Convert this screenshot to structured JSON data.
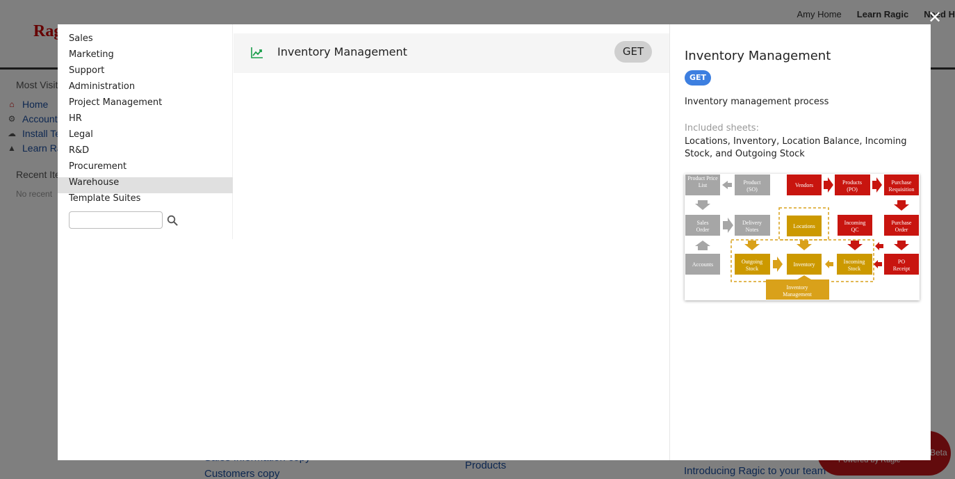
{
  "background": {
    "logo": "Rag",
    "user_menu": [
      "Amy Home",
      "Learn Ragic",
      "Need H"
    ],
    "sidebar": {
      "most_visited_title": "Most Visit",
      "items": [
        {
          "label": "Home",
          "icon": "home-icon"
        },
        {
          "label": "Account",
          "icon": "gear-icon"
        },
        {
          "label": "Install Te",
          "icon": "cloud-download-icon"
        },
        {
          "label": "Learn Ra",
          "icon": "graduation-cap-icon"
        }
      ],
      "recent_title": "Recent Ite",
      "recent_empty": "No recent"
    },
    "links": [
      "Sales Information copy",
      "Customers copy",
      "Products",
      "Introducing Ragic to your team"
    ],
    "fab": {
      "label": "Powered by Ragic",
      "beta": "Beta"
    }
  },
  "modal": {
    "categories": [
      {
        "label": "Sales",
        "active": false
      },
      {
        "label": "Marketing",
        "active": false
      },
      {
        "label": "Support",
        "active": false
      },
      {
        "label": "Administration",
        "active": false
      },
      {
        "label": "Project Management",
        "active": false
      },
      {
        "label": "HR",
        "active": false
      },
      {
        "label": "Legal",
        "active": false
      },
      {
        "label": "R&D",
        "active": false
      },
      {
        "label": "Procurement",
        "active": false
      },
      {
        "label": "Warehouse",
        "active": true
      },
      {
        "label": "Template Suites",
        "active": false
      }
    ],
    "search": {
      "value": "",
      "placeholder": ""
    },
    "template_list": [
      {
        "title": "Inventory Management",
        "icon": "line-chart-icon",
        "button": "GET"
      }
    ],
    "detail": {
      "title": "Inventory Management",
      "get_label": "GET",
      "description": "Inventory management process",
      "sheets_label": "Included sheets:",
      "sheets": "Locations, Inventory, Location Balance, Incoming Stock, and Outgoing Stock",
      "diagram": {
        "nodes": {
          "product_price_list": "Product Price List",
          "product_so": "Product (SO)",
          "vendors": "Vendors",
          "products_po": "Products (PO)",
          "purchase_requisition": "Purchase Requisition",
          "sales_order": "Sales Order",
          "delivery_notes": "Delivery Notes",
          "locations": "Locations",
          "incoming_qc": "Incoming QC",
          "purchase_order": "Purchase Order",
          "accounts": "Accounts",
          "outgoing_stock": "Outgoing Stock",
          "inventory": "Inventory",
          "incoming_stock": "Incoming Stock",
          "po_receipt": "PO Receipt",
          "inventory_management": "Inventory Management"
        }
      }
    },
    "colors": {
      "active_bg": "#e0e0e0",
      "get_blue": "#3d7fe0",
      "gray_node": "#a6a6a6",
      "red_node": "#c8150f",
      "gold_node": "#cc9900",
      "chart_green": "#1a9e4b"
    }
  }
}
